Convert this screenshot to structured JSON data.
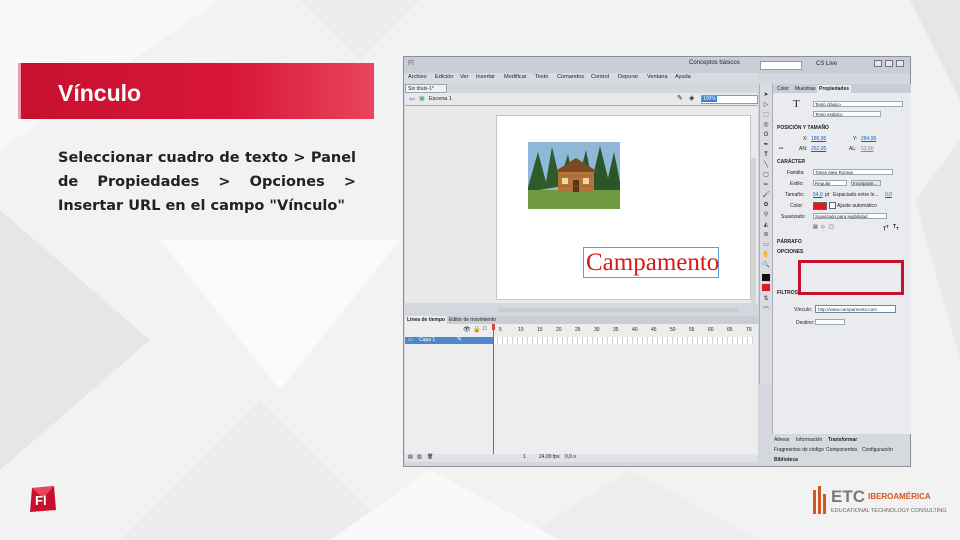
{
  "slide": {
    "title": "Vínculo",
    "body": "Seleccionar cuadro de texto > Panel de Propiedades > Opciones > Insertar URL en el campo \"Vínculo\"",
    "accent_color": "#c8102e"
  },
  "app": {
    "app_icon": "Fl",
    "workspace": "Conceptos básicos",
    "cs_live": "CS Live",
    "menu": [
      "Archivo",
      "Edición",
      "Ver",
      "Insertar",
      "Modificar",
      "Texto",
      "Comandos",
      "Control",
      "Depurar",
      "Ventana",
      "Ayuda"
    ],
    "doc_tab": "Sin título-1*",
    "scene": "Escena 1",
    "zoom": "100%",
    "stage_text": "Campamento",
    "timeline": {
      "tabs": [
        "Línea de tiempo",
        "Editor de movimiento"
      ],
      "layer": "Capa 1",
      "ruler": [
        "5",
        "10",
        "15",
        "20",
        "25",
        "30",
        "35",
        "40",
        "45",
        "50",
        "55",
        "60",
        "65",
        "70"
      ],
      "fps": "24,00 fps",
      "time": "0,0 s",
      "frame": "1"
    },
    "properties": {
      "tabs": [
        "Color",
        "Muestras",
        "Propiedades"
      ],
      "text_engine": "Texto clásico",
      "text_type": "Texto estático",
      "sections": {
        "position": "POSICIÓN Y TAMAÑO",
        "character": "CARÁCTER",
        "paragraph": "PÁRRAFO",
        "options": "OPCIONES",
        "filters": "FILTROS"
      },
      "x_label": "X:",
      "x_value": "186,95",
      "y_label": "Y:",
      "y_value": "284,95",
      "w_label": "AN:",
      "w_value": "252,05",
      "h_label": "AL:",
      "h_value": "53,80",
      "family_label": "Familia:",
      "family_value": "Times New Roman",
      "style_label": "Estilo:",
      "style_value": "Regular",
      "embed_label": "Incorporar...",
      "size_label": "Tamaño:",
      "size_value": "54,0",
      "size_unit": "pt",
      "spacing_label": "Espaciado entre le...",
      "spacing_value": "0,0",
      "color_label": "Color:",
      "auto_adjust": "Ajuste automático",
      "smooth_label": "Suavizado:",
      "smooth_value": "Suavizado para legibilidad",
      "link_label": "Vínculo:",
      "link_value": "http://www.campamento.com",
      "target_label": "Destino:",
      "text_color": "#e8141e"
    },
    "bottom_tabs": [
      "Alinear",
      "Información",
      "Transformar"
    ],
    "bottom_tabs2": [
      "Fragmentos de código",
      "Componentes",
      "Configuración"
    ],
    "library": "Biblioteca"
  },
  "logos": {
    "fl": "Fl",
    "etc_main": "ETC",
    "etc_ibero": "IBEROAMÉRICA",
    "etc_sub": "EDUCATIONAL TECHNOLOGY CONSULTING"
  }
}
